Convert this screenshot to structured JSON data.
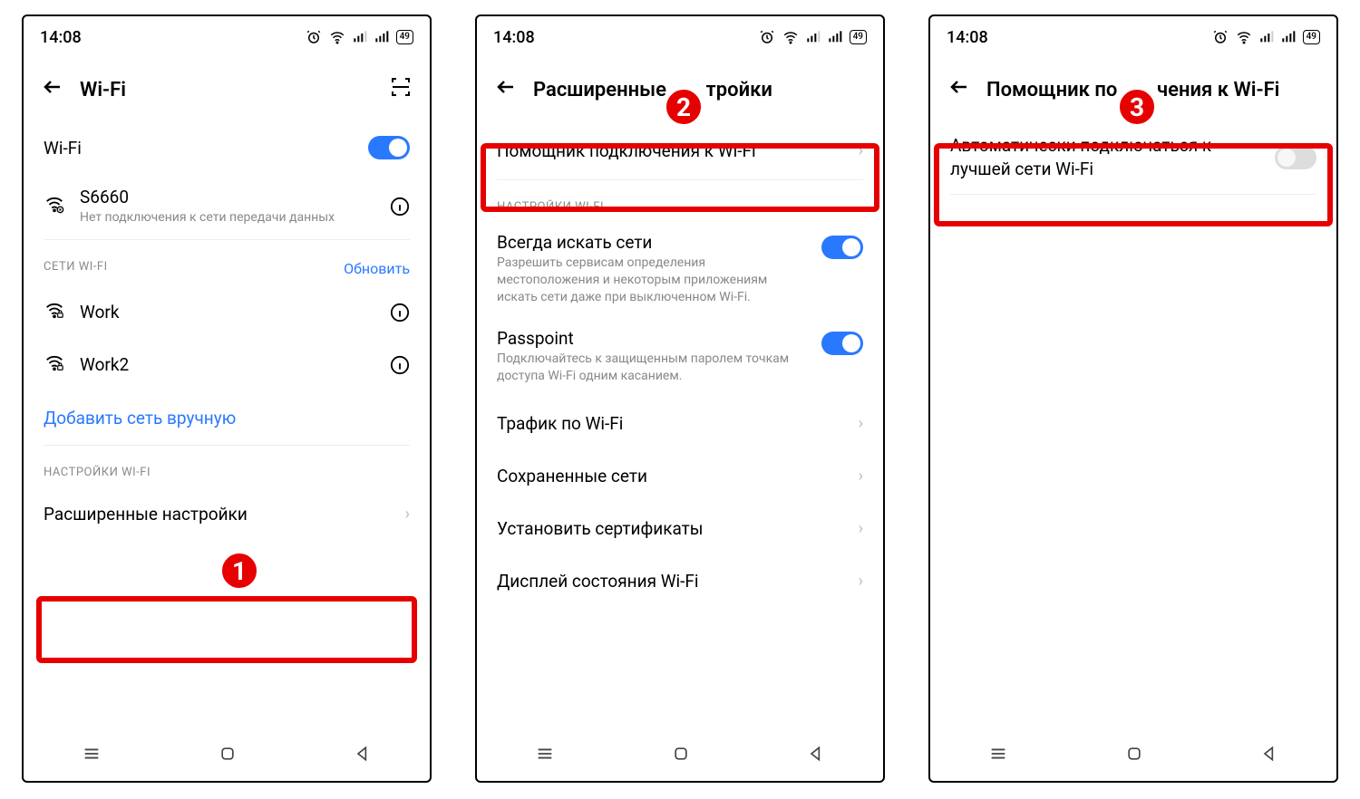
{
  "status": {
    "time": "14:08",
    "battery": "49"
  },
  "screen1": {
    "title": "Wi-Fi",
    "wifi_toggle_label": "Wi-Fi",
    "connected": {
      "name": "S6660",
      "sub": "Нет подключения к сети передачи данных"
    },
    "section_networks": "СЕТИ WI-FI",
    "refresh": "Обновить",
    "net1": "Work",
    "net2": "Work2",
    "add_manual": "Добавить сеть вручную",
    "section_settings": "НАСТРОЙКИ WI-FI",
    "advanced": "Расширенные настройки",
    "step": "1"
  },
  "screen2": {
    "title_a": "Расширенные",
    "title_b": "тройки",
    "assistant": "Помощник подключения к Wi-Fi",
    "section_wifi": "НАСТРОЙКИ WI-FI",
    "scan_title": "Всегда искать сети",
    "scan_sub": "Разрешить сервисам определения местоположения и некоторым приложениям искать сети даже при выключенном Wi-Fi.",
    "passpoint_title": "Passpoint",
    "passpoint_sub": "Подключайтесь к защищенным паролем точкам доступа Wi-Fi одним касанием.",
    "traffic": "Трафик по Wi-Fi",
    "saved": "Сохраненные сети",
    "certs": "Установить сертификаты",
    "display": "Дисплей состояния Wi-Fi",
    "step": "2"
  },
  "screen3": {
    "title_a": "Помощник по",
    "title_b": "чения к Wi-Fi",
    "auto_best": "Автоматически подключаться к лучшей сети Wi-Fi",
    "step": "3"
  }
}
